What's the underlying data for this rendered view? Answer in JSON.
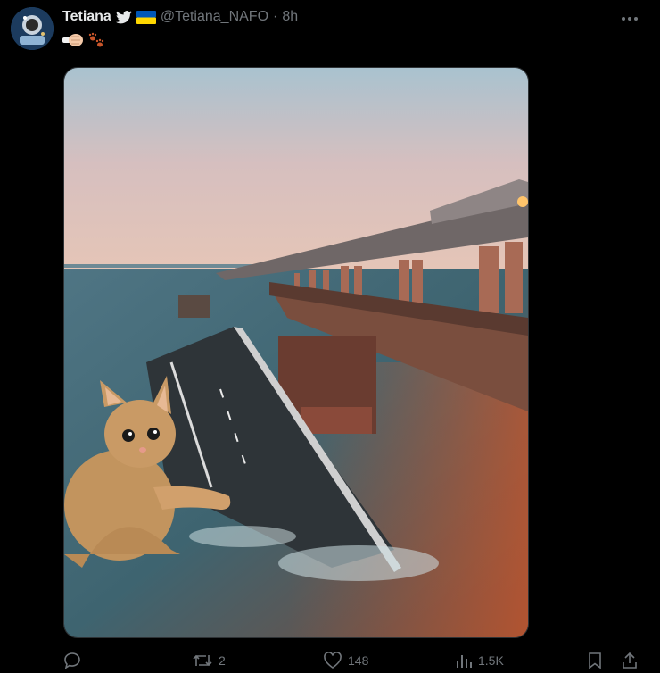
{
  "tweet": {
    "author_name": "Tetiana",
    "handle": "@Tetiana_NAFO",
    "separator": "·",
    "time": "8h",
    "icons": [
      "twitter-bird-icon",
      "ukraine-flag-icon",
      "more-icon",
      "fist-emoji",
      "paw-prints-emoji"
    ]
  },
  "media": {
    "description_icon": "photo of collapsed bridge with cat"
  },
  "actions": {
    "reply_count": "",
    "retweet_count": "2",
    "like_count": "148",
    "view_count": "1.5K"
  },
  "colors": {
    "background": "#000000",
    "text_primary": "#e7e9ea",
    "text_secondary": "#71767b",
    "twitter_blue": "#1d9bf0",
    "flag_blue": "#0057b7",
    "flag_yellow": "#ffd700"
  }
}
